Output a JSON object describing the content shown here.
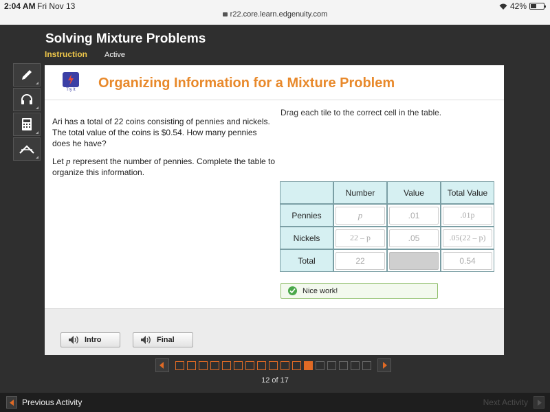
{
  "status_bar": {
    "time": "2:04 AM",
    "date": "Fri Nov 13",
    "url": "r22.core.learn.edgenuity.com",
    "battery": "42%",
    "battery_level": 0.42
  },
  "lesson": {
    "title": "Solving Mixture Problems",
    "tab": "Instruction",
    "status": "Active"
  },
  "tools": [
    "pencil-icon",
    "headphones-icon",
    "calculator-icon",
    "formula-icon"
  ],
  "activity": {
    "badge_label": "Try It",
    "title": "Organizing Information for a Mixture Problem",
    "problem_text": "Ari has a total of 22 coins consisting of pennies and nickels. The total value of the coins is $0.54. How many pennies does he have?",
    "prompt_before": "Let ",
    "prompt_var": "p",
    "prompt_after": " represent the number of pennies. Complete the table to organize this information.",
    "instruction": "Drag each tile to the correct cell in the table."
  },
  "table": {
    "headers": [
      "",
      "Number",
      "Value",
      "Total Value"
    ],
    "rows": [
      {
        "label": "Pennies",
        "number": "p",
        "value": ".01",
        "total": ".01p"
      },
      {
        "label": "Nickels",
        "number": "22 – p",
        "value": ".05",
        "total": ".05(22 – p)"
      },
      {
        "label": "Total",
        "number": "22",
        "value": "",
        "total": "0.54"
      }
    ]
  },
  "feedback": "Nice work!",
  "footer_buttons": {
    "intro": "Intro",
    "final": "Final"
  },
  "pager": {
    "current": 12,
    "total": 17,
    "label": "12 of 17"
  },
  "bottom_nav": {
    "previous": "Previous Activity",
    "next": "Next Activity"
  },
  "colors": {
    "accent_orange": "#e8892b",
    "tab_yellow": "#f0c84a",
    "table_header": "#d6f0f2",
    "success_green": "#4aa84a",
    "pager_orange": "#e06a25"
  }
}
